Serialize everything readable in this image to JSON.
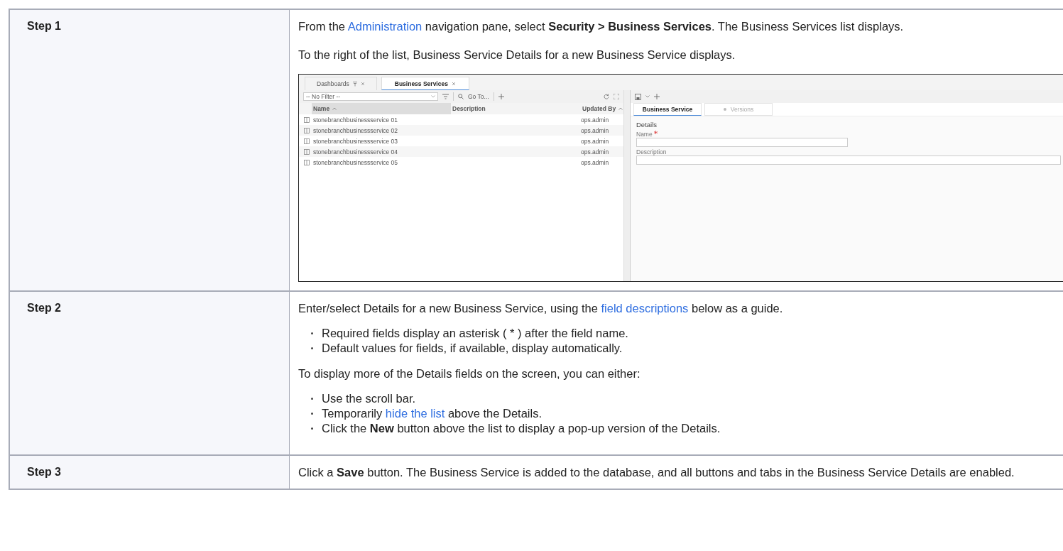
{
  "steps": [
    {
      "label": "Step 1",
      "content": [
        {
          "kind": "paragraph",
          "parts": [
            {
              "text": "From the "
            },
            {
              "text": "Administration",
              "link": true
            },
            {
              "text": " navigation pane, select **Security > Business Services**. The Business Services list displays."
            }
          ]
        },
        {
          "kind": "paragraph",
          "parts": [
            {
              "text": "To the right of the list, Business Service Details for a new Business Service displays."
            }
          ]
        },
        {
          "kind": "screenshot",
          "shot": {
            "tabs": [
              {
                "label": "Dashboards",
                "selected": false,
                "pinned": true
              },
              {
                "label": "Business Services",
                "selected": true,
                "pinned": false
              }
            ],
            "filter": {
              "value": "-- No Filter --"
            },
            "goto": "Go To...",
            "columns": [
              {
                "label": "Name",
                "sorted": true,
                "selected": true
              },
              {
                "label": "Description",
                "sorted": false,
                "selected": false
              },
              {
                "label": "Updated By",
                "sorted": true,
                "selected": false
              }
            ],
            "rows": [
              {
                "name": "stonebranchbusinessservice 01",
                "updated_by": "ops.admin"
              },
              {
                "name": "stonebranchbusinessservice 02",
                "updated_by": "ops.admin"
              },
              {
                "name": "stonebranchbusinessservice 03",
                "updated_by": "ops.admin"
              },
              {
                "name": "stonebranchbusinessservice 04",
                "updated_by": "ops.admin"
              },
              {
                "name": "stonebranchbusinessservice 05",
                "updated_by": "ops.admin"
              }
            ],
            "detail_tabs": [
              {
                "label": "Business Service",
                "selected": true,
                "disabled": false
              },
              {
                "label": "Versions",
                "selected": false,
                "disabled": true
              }
            ],
            "section": "Details",
            "fields": [
              {
                "label": "Name",
                "required": true,
                "kind": "short"
              },
              {
                "label": "Description",
                "required": false,
                "kind": "wide"
              }
            ]
          }
        }
      ]
    },
    {
      "label": "Step 2",
      "content": [
        {
          "kind": "paragraph",
          "parts": [
            {
              "text": "Enter/select Details for a new Business Service, using the "
            },
            {
              "text": "field descriptions",
              "link": true
            },
            {
              "text": " below as a guide."
            }
          ]
        },
        {
          "kind": "bullets",
          "items": [
            [
              {
                "text": "Required fields display an asterisk ( * ) after the field name."
              }
            ],
            [
              {
                "text": "Default values for fields, if available, display automatically."
              }
            ]
          ]
        },
        {
          "kind": "paragraph",
          "parts": [
            {
              "text": "To display more of the Details fields on the screen, you can either:"
            }
          ]
        },
        {
          "kind": "bullets",
          "items": [
            [
              {
                "text": "Use the scroll bar."
              }
            ],
            [
              {
                "text": "Temporarily "
              },
              {
                "text": "hide the list",
                "link": true
              },
              {
                "text": " above the Details."
              }
            ],
            [
              {
                "text": "Click the **New** button above the list to display a pop-up version of the Details."
              }
            ]
          ]
        }
      ]
    },
    {
      "label": "Step 3",
      "content": [
        {
          "kind": "paragraph",
          "parts": [
            {
              "text": "Click a **Save** button. The Business Service is added to the database, and all buttons and tabs in the Business Service Details are enabled."
            }
          ]
        }
      ]
    }
  ]
}
